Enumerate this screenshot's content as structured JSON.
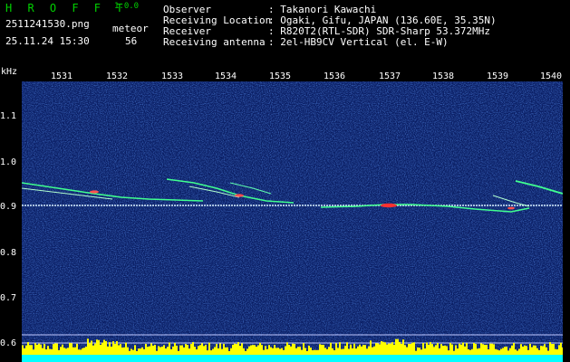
{
  "header": {
    "app_title": "H R O F F T",
    "version": "1.0.0",
    "filename": "2511241530.png",
    "datetime": "25.11.24 15:30",
    "counter_label": "meteor",
    "counter_value": "56"
  },
  "station": {
    "observer_label": "Observer",
    "observer_value": ": Takanori Kawachi",
    "location_label": "Receiving Location",
    "location_value": ": Ogaki, Gifu, JAPAN (136.60E, 35.35N)",
    "receiver_label": "Receiver",
    "receiver_value": ": R820T2(RTL-SDR) SDR-Sharp 53.372MHz",
    "antenna_label": "Receiving antenna",
    "antenna_value": ": 2el-HB9CV Vertical (el. E-W)"
  },
  "axes": {
    "y_unit": "kHz",
    "x_ticks": [
      "1531",
      "1532",
      "1533",
      "1534",
      "1535",
      "1536",
      "1537",
      "1538",
      "1539",
      "1540"
    ],
    "y_ticks": [
      "1.1",
      "1.0",
      "0.9",
      "0.8",
      "0.7",
      "0.6"
    ]
  },
  "colors": {
    "background": "#0a1e64",
    "header_text": "#00d000",
    "labels": "#ffffff",
    "carrier": "#ffffff",
    "echo": "#40ff90",
    "peak": "#ff3030",
    "bars_yellow": "#ffff00",
    "bars_cyan": "#00ffff"
  }
}
